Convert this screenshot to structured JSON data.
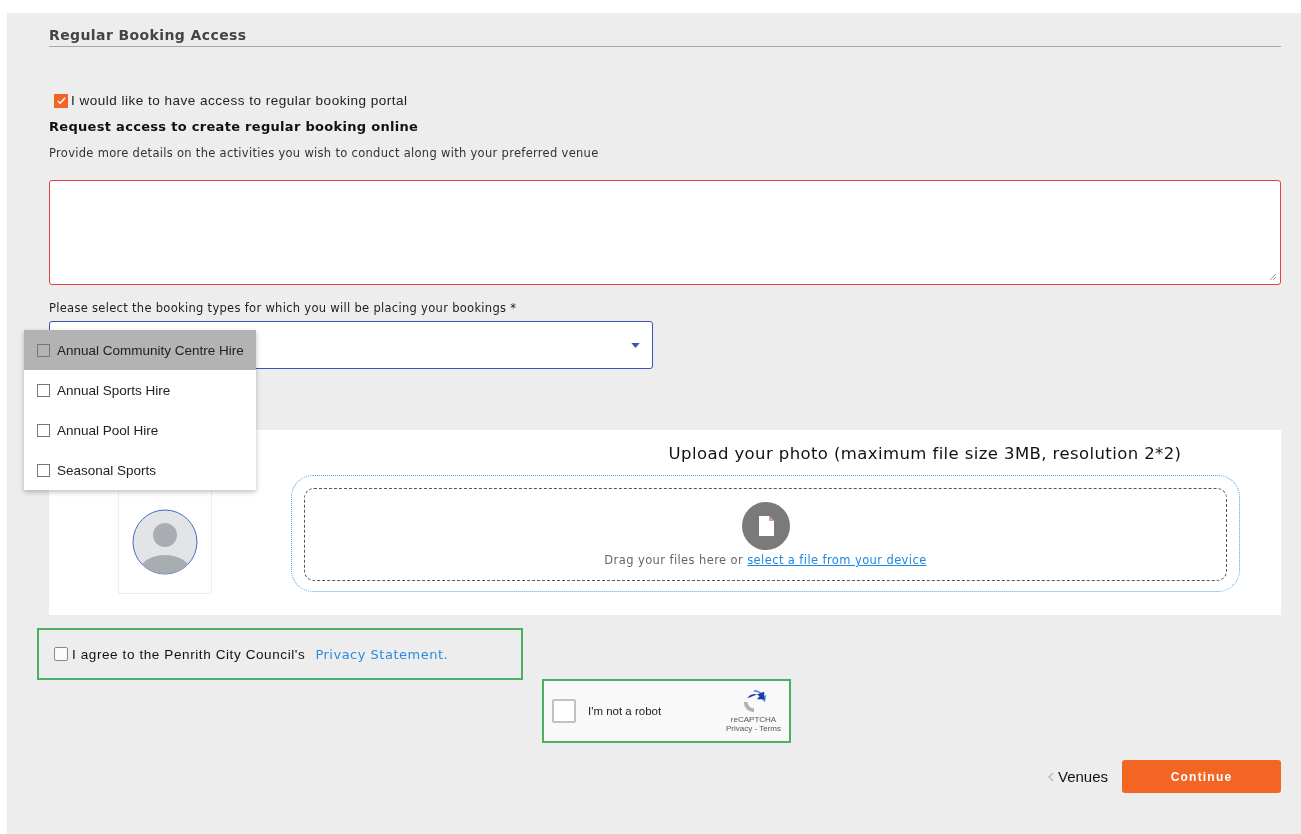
{
  "section_title": "Regular Booking Access",
  "access_checkbox": {
    "label": "I would like to have access to regular booking portal",
    "checked": true
  },
  "request_title": "Request access to create regular booking online",
  "request_hint": "Provide more details on the activities you wish to conduct along with your preferred venue",
  "details_field": {
    "invalid": true
  },
  "booking_types": {
    "label": "Please select the booking types for which you will be placing your bookings *",
    "expanded": true,
    "options": [
      {
        "label": "Annual Community Centre Hire",
        "checked": false,
        "highlighted": true
      },
      {
        "label": "Annual Sports Hire",
        "checked": false,
        "highlighted": false
      },
      {
        "label": "Annual Pool Hire",
        "checked": false,
        "highlighted": false
      },
      {
        "label": "Seasonal Sports",
        "checked": false,
        "highlighted": false
      }
    ]
  },
  "upload": {
    "title": "Upload your photo (maximum file size 3MB, resolution 2*2)",
    "drop_text": "Drag your files here or",
    "link": "select a file from your device"
  },
  "agreement": {
    "label": "I agree to the Penrith City Council's",
    "link": "Privacy Statement.",
    "checked": false
  },
  "captcha": {
    "label": "I'm not a robot",
    "brand": "reCAPTCHA",
    "terms": "Privacy - Terms",
    "checked": false
  },
  "footer": {
    "back": "Venues",
    "continue": "Continue"
  }
}
